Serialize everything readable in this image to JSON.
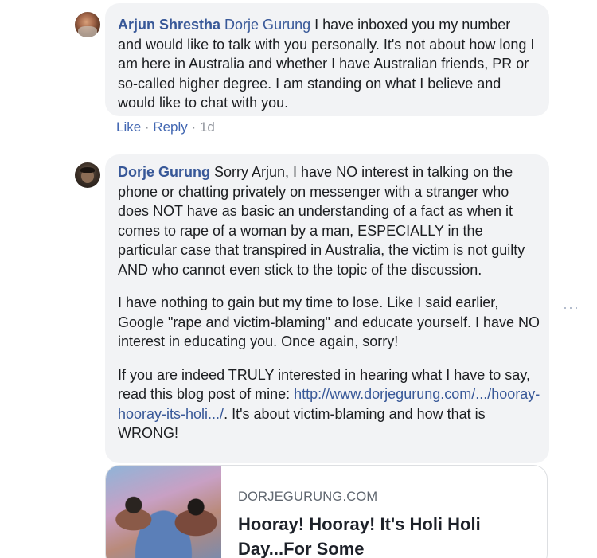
{
  "comment_1": {
    "author": "Arjun Shrestha",
    "mention": "Dorje Gurung",
    "text": " I have inboxed you my number and would like to talk with you personally. It's not about how long I am here in Australia and whether I have Australian friends, PR or so-called higher degree. I am standing on what I believe and would like to chat with you.",
    "actions": {
      "like": "Like",
      "sep1": " · ",
      "reply": "Reply",
      "sep2": " · ",
      "time": "1d"
    }
  },
  "comment_2": {
    "author": "Dorje Gurung",
    "para_1": " Sorry Arjun, I have NO interest in talking on the phone or chatting privately on messenger with a stranger who does NOT have as basic an understanding of a fact as when it comes to rape of a woman by a man, ESPECIALLY in the particular case that transpired in Australia, the victim is not guilty AND who cannot even stick to the topic of the discussion.",
    "para_2": "I have nothing to gain but my time to lose. Like I said earlier, Google \"rape and victim-blaming\" and educate yourself. I have NO interest in educating you. Once again, sorry!",
    "para_3_before": "If you are indeed TRULY interested in hearing what I have to say, read this blog post of mine: ",
    "para_3_link": "http://www.dorjegurung.com/.../hooray-hooray-its-holi.../",
    "para_3_after": ". It's about victim-blaming and how that is WRONG!",
    "more_options": "···"
  },
  "link_preview": {
    "domain": "DORJEGURUNG.COM",
    "title": "Hooray! Hooray! It's Holi Holi Day...For Some"
  }
}
